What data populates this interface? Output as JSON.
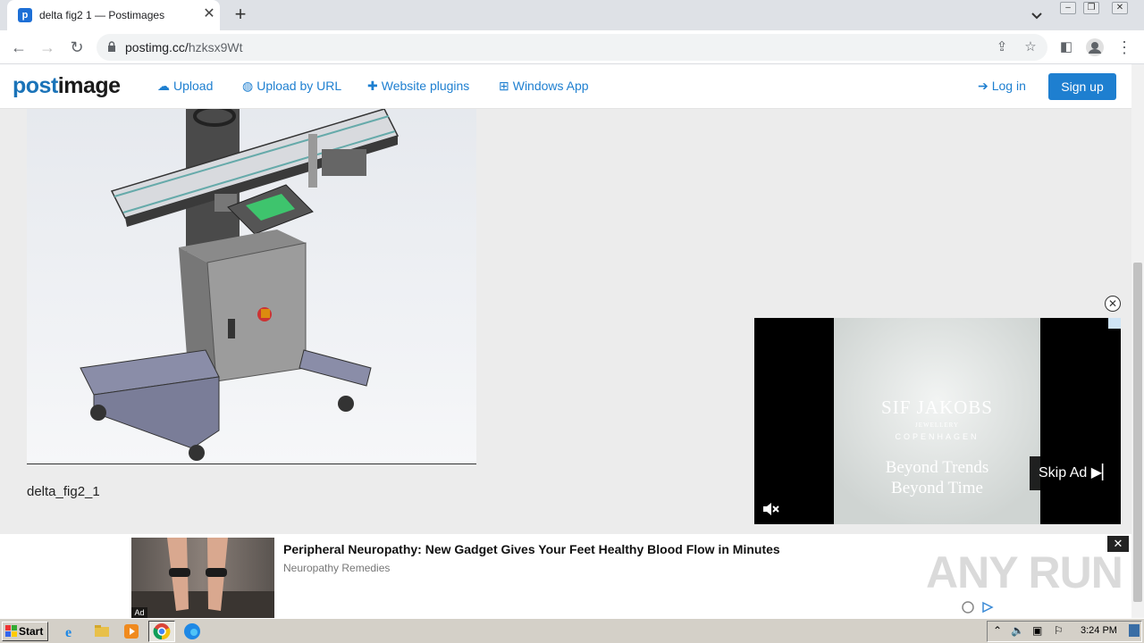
{
  "browser": {
    "tab_title": "delta fig2 1 — Postimages",
    "tab_favicon_letter": "p",
    "url_domain": "postimg.cc/",
    "url_path": "hzksx9Wt"
  },
  "site": {
    "logo_part1": "post",
    "logo_part2": "image",
    "nav": [
      {
        "label": "Upload",
        "icon": "cloud-upload-icon"
      },
      {
        "label": "Upload by URL",
        "icon": "globe-icon"
      },
      {
        "label": "Website plugins",
        "icon": "puzzle-icon"
      },
      {
        "label": "Windows App",
        "icon": "windows-icon"
      }
    ],
    "login_label": "Log in",
    "signup_label": "Sign up",
    "accent": "#1e7fd0"
  },
  "image": {
    "caption": "delta_fig2_1"
  },
  "video_ad": {
    "brand": "SIF JAKOBS",
    "brand_sub1": "JEWELLERY",
    "brand_sub2": "COPENHAGEN",
    "tagline1": "Beyond Trends",
    "tagline2": "Beyond Time",
    "skip_label": "Skip Ad"
  },
  "bottom_ad": {
    "badge": "Ad",
    "headline": "Peripheral Neuropathy: New Gadget Gives Your Feet Healthy Blood Flow in Minutes",
    "source": "Neuropathy Remedies"
  },
  "watermark": "ANY RUN",
  "taskbar": {
    "start_label": "Start",
    "clock": "3:24 PM"
  }
}
